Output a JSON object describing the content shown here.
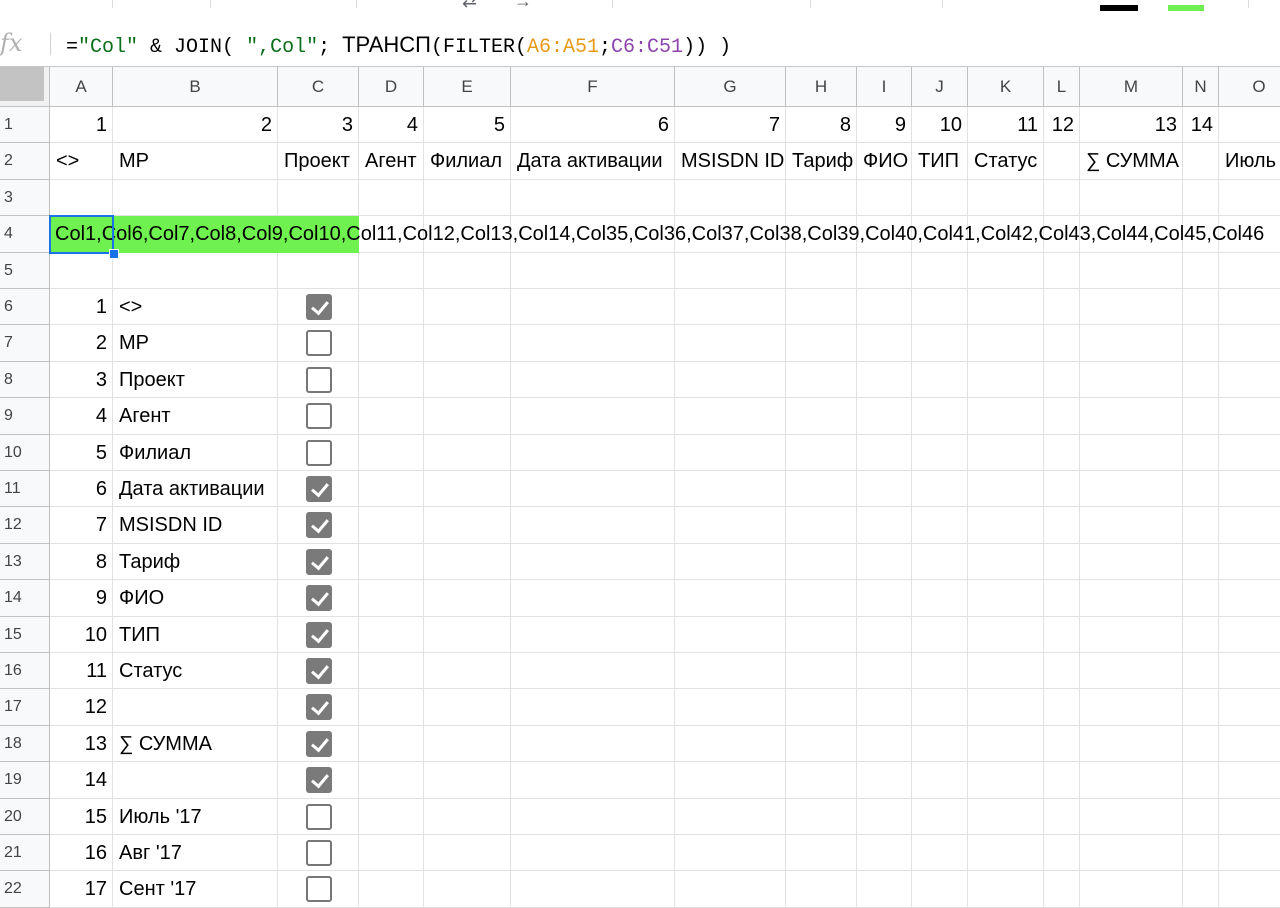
{
  "formula": {
    "fx_label": "fx",
    "part1": "=",
    "str1": "\"Col\"",
    "part2": " & JOIN( ",
    "str2": "\",Col\"",
    "part3": "; ",
    "func": "ТРАНСП",
    "part4": "(FILTER(",
    "range1": "A6:A51",
    "part5": ";",
    "range2": "C6:C51",
    "part6": ")) )"
  },
  "columns": [
    "A",
    "B",
    "C",
    "D",
    "E",
    "F",
    "G",
    "H",
    "I",
    "J",
    "K",
    "L",
    "M",
    "N",
    "O"
  ],
  "row1": [
    "1",
    "2",
    "3",
    "4",
    "5",
    "6",
    "7",
    "8",
    "9",
    "10",
    "11",
    "12",
    "13",
    "14"
  ],
  "row2": [
    "<>",
    "MP",
    "Проект",
    "Агент",
    "Филиал",
    "Дата активации",
    "MSISDN ID",
    "Тариф",
    "ФИО",
    "ТИП",
    "Статус",
    "",
    "∑ СУММА",
    "",
    "Июль"
  ],
  "row4_text": "Col1,Col6,Col7,Col8,Col9,Col10,Col11,Col12,Col13,Col14,Col35,Col36,Col37,Col38,Col39,Col40,Col41,Col42,Col43,Col44,Col45,Col46",
  "row_numbers": [
    "1",
    "2",
    "3",
    "4",
    "5",
    "6",
    "7",
    "8",
    "9",
    "10",
    "11",
    "12",
    "13",
    "14",
    "15",
    "16",
    "17",
    "18",
    "19",
    "20",
    "21",
    "22"
  ],
  "list_rows": [
    {
      "n": "1",
      "label": "<>",
      "checked": true
    },
    {
      "n": "2",
      "label": "MP",
      "checked": false
    },
    {
      "n": "3",
      "label": "Проект",
      "checked": false
    },
    {
      "n": "4",
      "label": "Агент",
      "checked": false
    },
    {
      "n": "5",
      "label": "Филиал",
      "checked": false
    },
    {
      "n": "6",
      "label": "Дата активации",
      "checked": true
    },
    {
      "n": "7",
      "label": "MSISDN ID",
      "checked": true
    },
    {
      "n": "8",
      "label": "Тариф",
      "checked": true
    },
    {
      "n": "9",
      "label": "ФИО",
      "checked": true
    },
    {
      "n": "10",
      "label": "ТИП",
      "checked": true
    },
    {
      "n": "11",
      "label": "Статус",
      "checked": true
    },
    {
      "n": "12",
      "label": "",
      "checked": true
    },
    {
      "n": "13",
      "label": "∑ СУММА",
      "checked": true
    },
    {
      "n": "14",
      "label": "",
      "checked": true
    },
    {
      "n": "15",
      "label": "Июль '17",
      "checked": false
    },
    {
      "n": "16",
      "label": "Авг '17",
      "checked": false
    },
    {
      "n": "17",
      "label": "Сент '17",
      "checked": false
    }
  ],
  "colors": {
    "highlight": "#6ff14f",
    "selection": "#1a73e8",
    "checkbox_checked": "#7a7a7a"
  }
}
